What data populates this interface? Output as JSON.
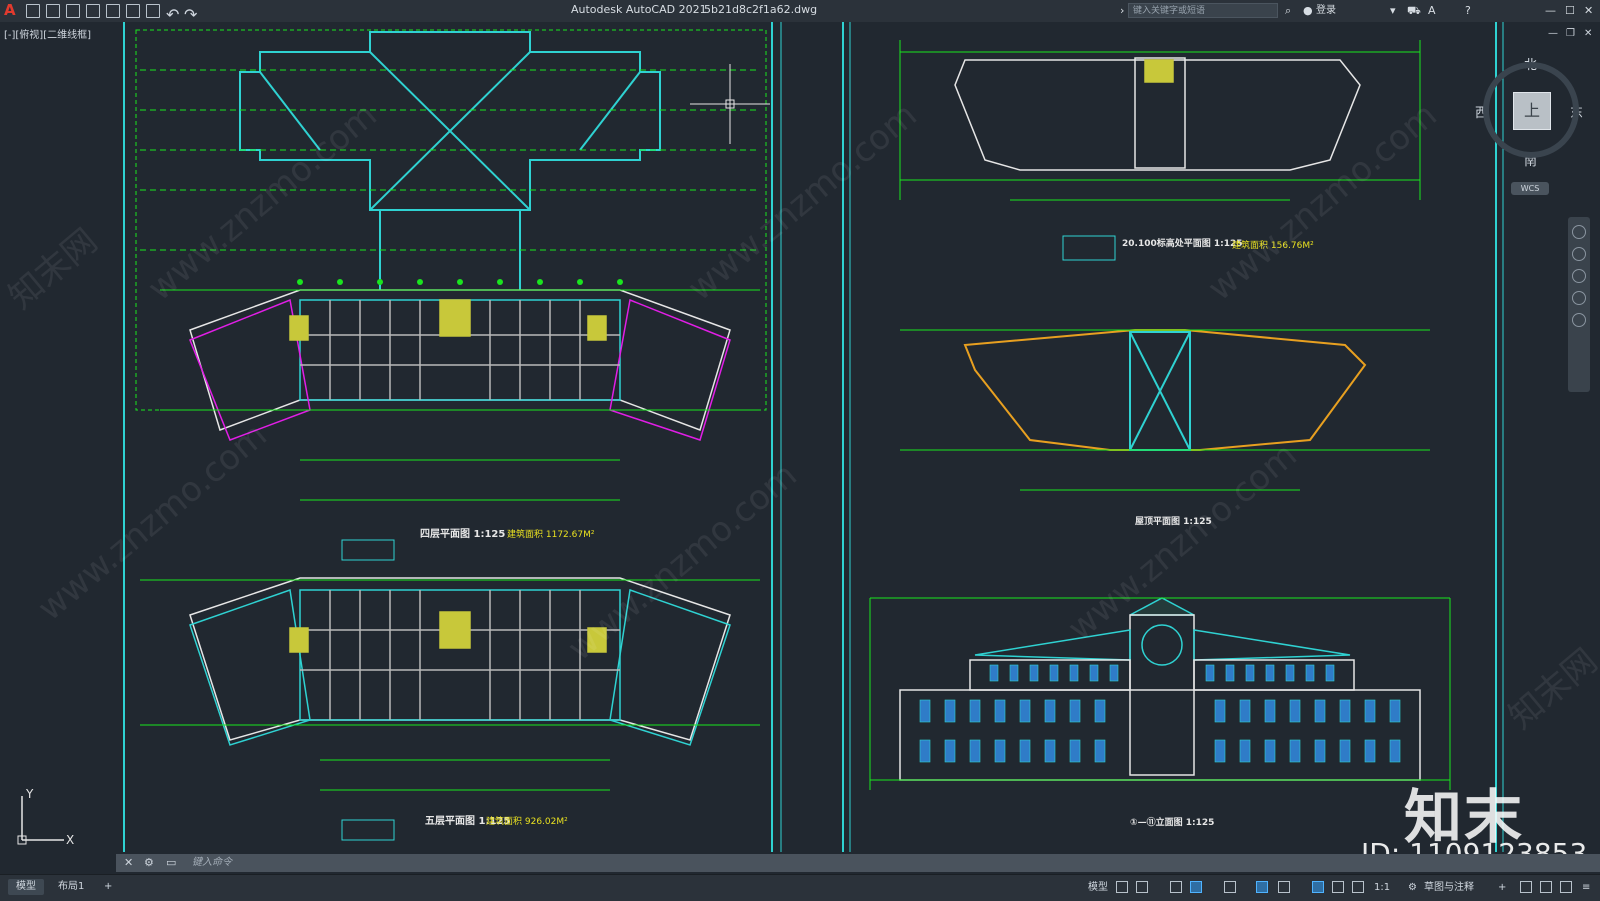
{
  "titlebar": {
    "app": "Autodesk AutoCAD 2021",
    "file": "5b21d8c2f1a62.dwg",
    "search_placeholder": "键入关键字或短语",
    "login": "登录"
  },
  "viewport": {
    "label": "[-][俯视][二维线框]"
  },
  "viewcube": {
    "north": "北",
    "south": "南",
    "east": "东",
    "west": "西",
    "face": "上",
    "wcs": "WCS"
  },
  "drawing": {
    "fourth_floor": "四层平面图 1:125",
    "fourth_floor_area": "建筑面积 1172.67M²",
    "fifth_floor": "五层平面图 1:125",
    "fifth_floor_area": "建筑面积 926.02M²",
    "roof_level_plan": "20.100标高处平面图 1:125",
    "roof_level_area": "建筑面积 156.76M²",
    "roof_plan": "屋顶平面图 1:125",
    "elevation": "①—⑪立面图 1:125"
  },
  "command": {
    "placeholder": "键入命令"
  },
  "status": {
    "tab_model": "模型",
    "tab_layout1": "布局1",
    "tab_add": "+",
    "model_label": "模型",
    "scale": "1:1",
    "workspace": "草图与注释"
  },
  "watermark": {
    "logo": "知末",
    "id": "ID: 1109123853",
    "site": "www.znzmo.com",
    "brand": "知末网"
  },
  "colors": {
    "background": "#212830",
    "line_green": "#19e61e",
    "line_cyan": "#2fd2d2",
    "line_magenta": "#e11ee6",
    "line_orange": "#e8a020",
    "line_white": "#e6e6e6"
  }
}
